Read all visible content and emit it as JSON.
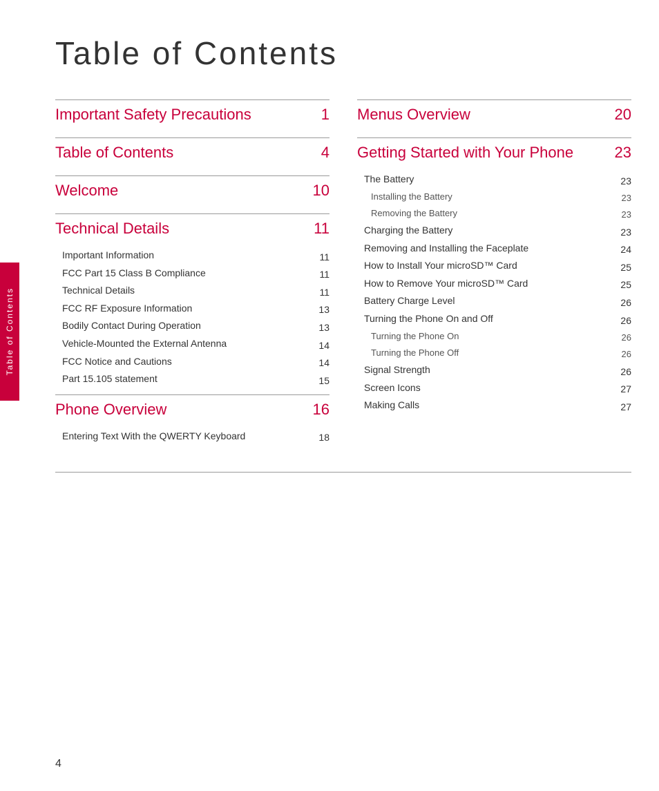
{
  "page": {
    "title": "Table of Contents",
    "page_number": "4",
    "sidebar_label": "Table of Contents"
  },
  "left_column": {
    "sections": [
      {
        "id": "important-safety",
        "title": "Important Safety Precautions",
        "page": "1",
        "level": "major",
        "divider": true,
        "subsections": []
      },
      {
        "id": "table-of-contents",
        "title": "Table of Contents",
        "page": "4",
        "level": "major",
        "divider": true,
        "subsections": []
      },
      {
        "id": "welcome",
        "title": "Welcome",
        "page": "10",
        "level": "major",
        "divider": true,
        "subsections": []
      },
      {
        "id": "technical-details",
        "title": "Technical Details",
        "page": "11",
        "level": "major",
        "divider": true,
        "subsections": [
          {
            "title": "Important Information",
            "page": "11",
            "level": "sub"
          },
          {
            "title": "FCC Part 15 Class B Compliance",
            "page": "11",
            "level": "sub"
          },
          {
            "title": "Technical Details",
            "page": "11",
            "level": "sub"
          },
          {
            "title": "FCC RF Exposure Information",
            "page": "13",
            "level": "sub"
          },
          {
            "title": "Bodily Contact During Operation",
            "page": "13",
            "level": "sub"
          },
          {
            "title": "Vehicle-Mounted the External Antenna",
            "page": "14",
            "level": "sub"
          },
          {
            "title": "FCC Notice and Cautions",
            "page": "14",
            "level": "sub"
          },
          {
            "title": "Part 15.105 statement",
            "page": "15",
            "level": "sub"
          }
        ]
      },
      {
        "id": "phone-overview",
        "title": "Phone Overview",
        "page": "16",
        "level": "major",
        "divider": true,
        "subsections": [
          {
            "title": "Entering Text With the QWERTY Keyboard",
            "page": "18",
            "level": "sub"
          }
        ]
      }
    ]
  },
  "right_column": {
    "sections": [
      {
        "id": "menus-overview",
        "title": "Menus Overview",
        "page": "20",
        "level": "major",
        "divider": true,
        "subsections": []
      },
      {
        "id": "getting-started",
        "title": "Getting Started with Your Phone",
        "page": "23",
        "level": "major",
        "divider": true,
        "subsections": [
          {
            "title": "The Battery",
            "page": "23",
            "level": "sub"
          },
          {
            "title": "Installing the Battery",
            "page": "23",
            "level": "subsub"
          },
          {
            "title": "Removing the Battery",
            "page": "23",
            "level": "subsub"
          },
          {
            "title": "Charging the Battery",
            "page": "23",
            "level": "sub"
          },
          {
            "title": "Removing and Installing the Faceplate",
            "page": "24",
            "level": "sub"
          },
          {
            "title": "How to Install Your microSD™ Card",
            "page": "25",
            "level": "sub"
          },
          {
            "title": "How to Remove Your microSD™ Card",
            "page": "25",
            "level": "sub"
          },
          {
            "title": "Battery Charge Level",
            "page": "26",
            "level": "sub"
          },
          {
            "title": "Turning the Phone On and Off",
            "page": "26",
            "level": "sub"
          },
          {
            "title": "Turning the Phone On",
            "page": "26",
            "level": "subsub"
          },
          {
            "title": "Turning the Phone Off",
            "page": "26",
            "level": "subsub"
          },
          {
            "title": "Signal Strength",
            "page": "26",
            "level": "sub"
          },
          {
            "title": "Screen Icons",
            "page": "27",
            "level": "sub"
          },
          {
            "title": "Making Calls",
            "page": "27",
            "level": "sub"
          }
        ]
      }
    ]
  }
}
